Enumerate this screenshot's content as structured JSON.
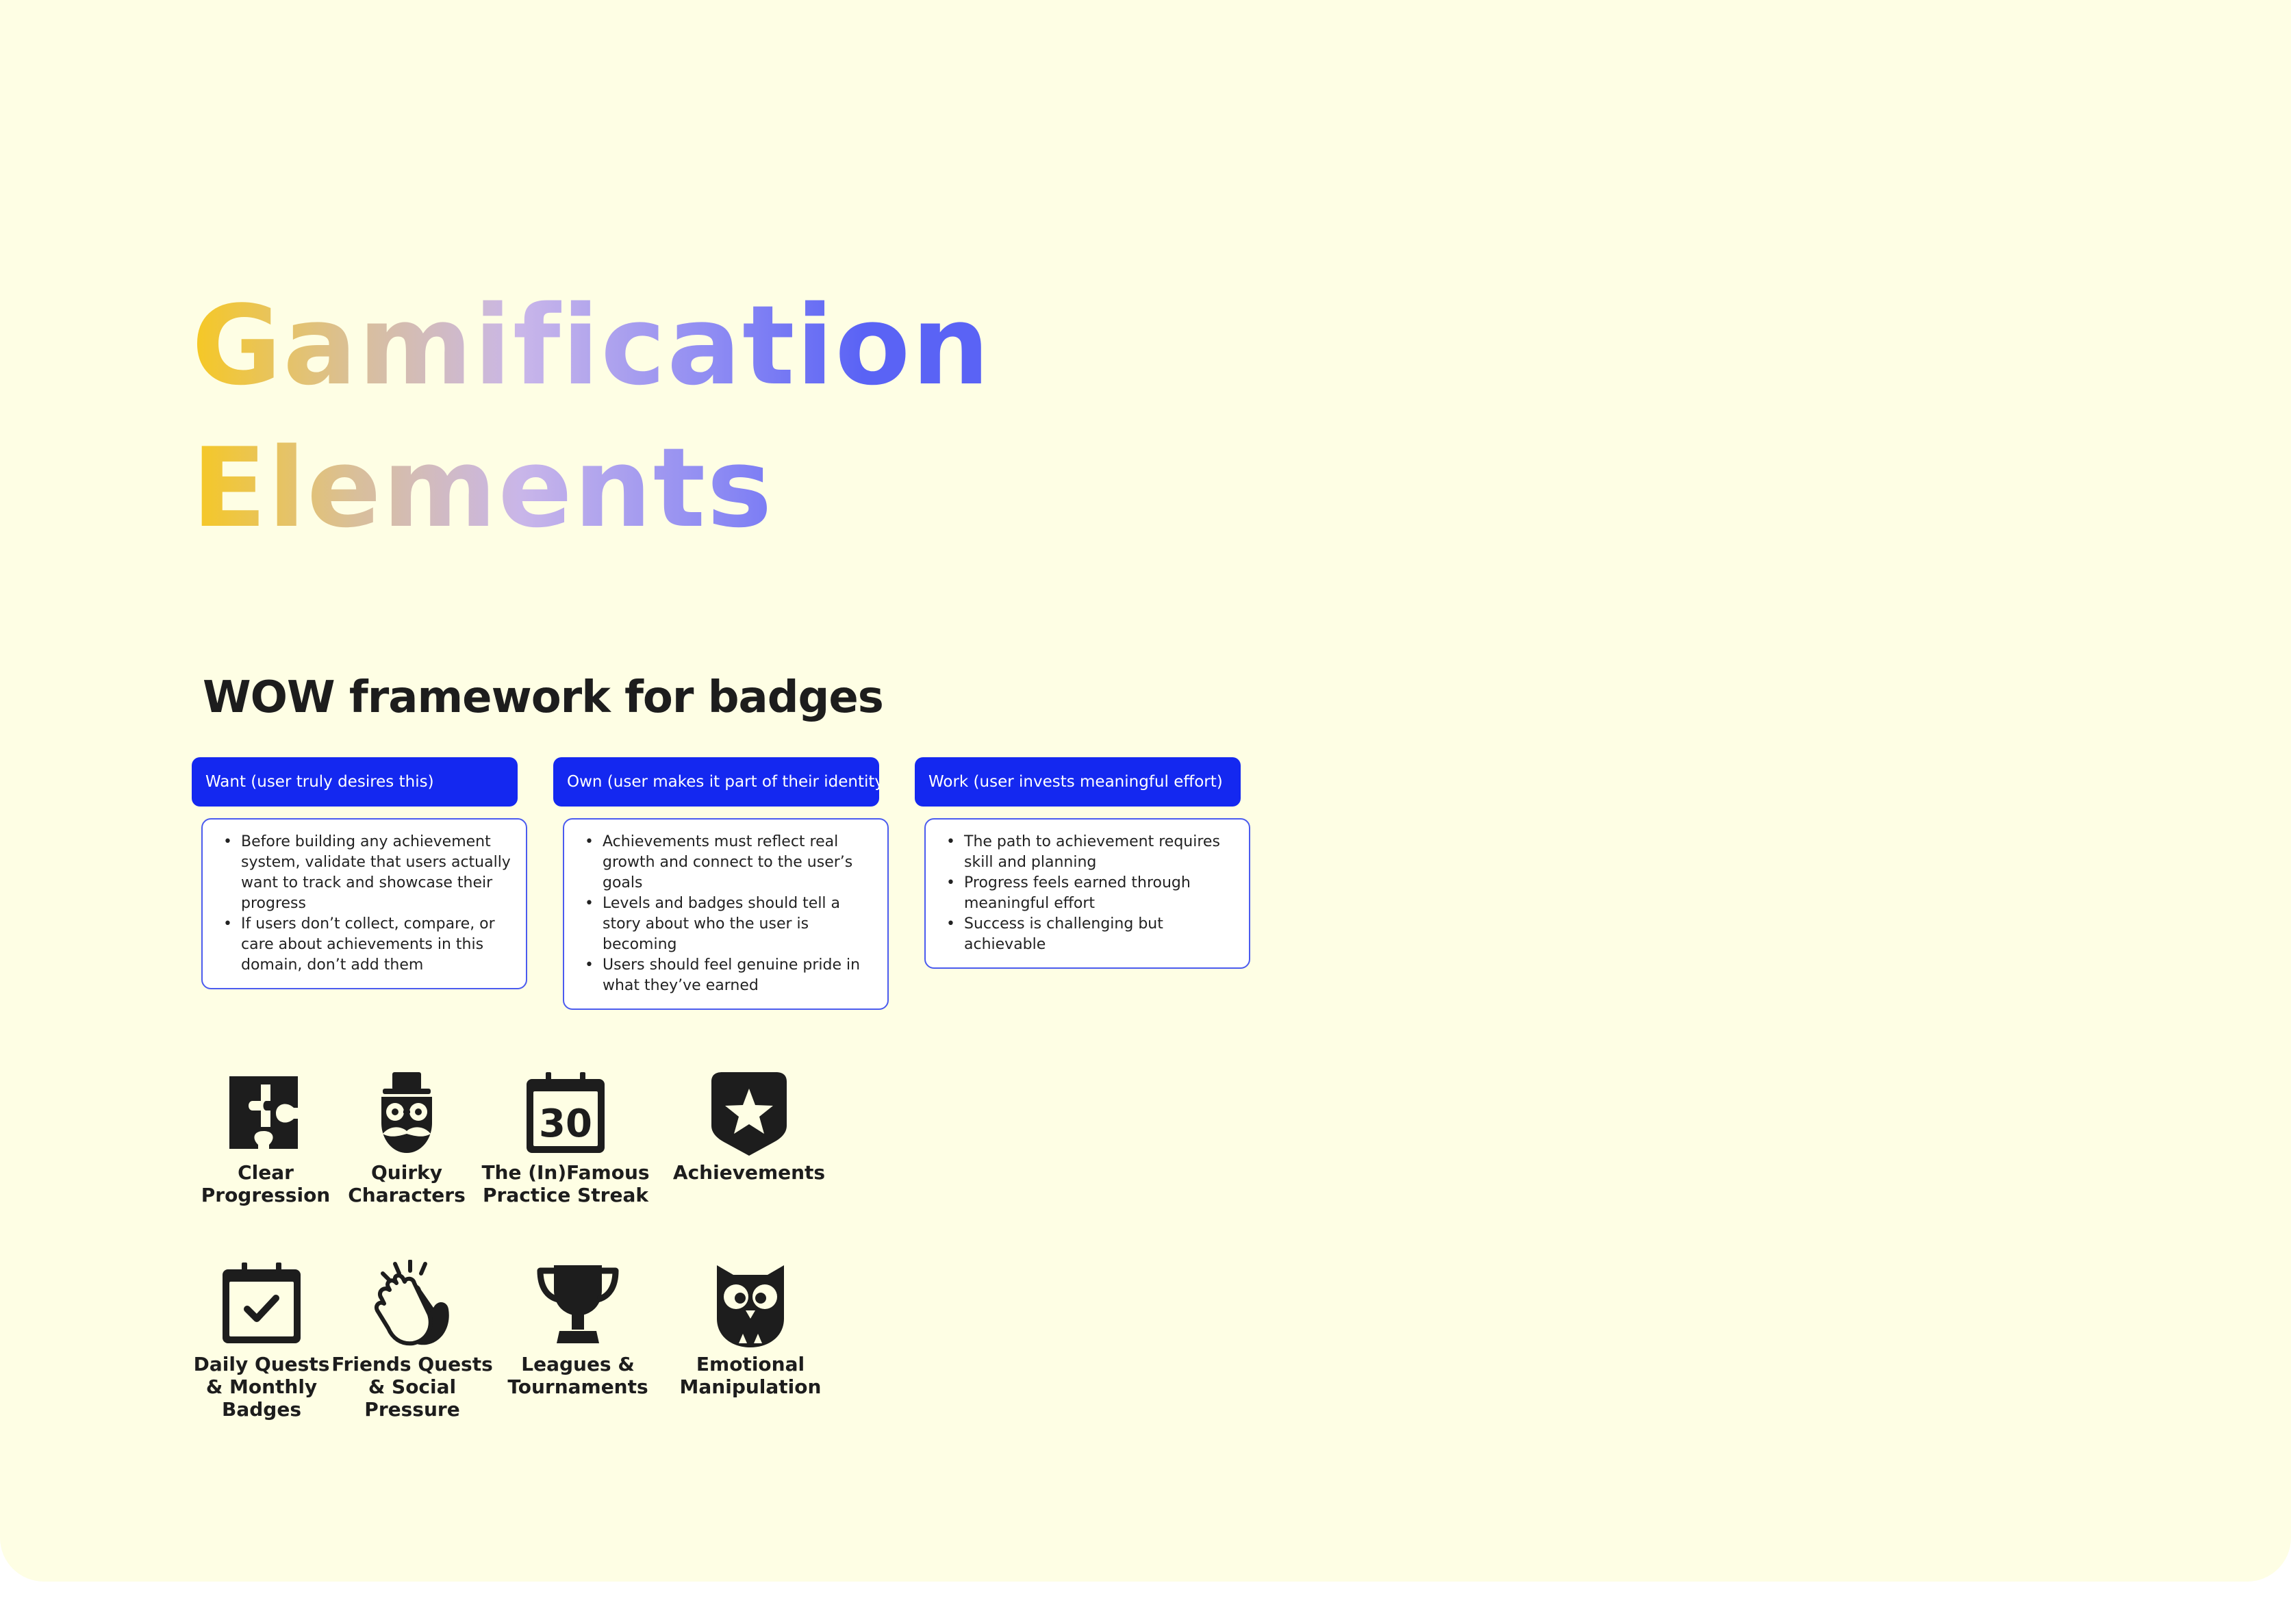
{
  "title": {
    "line1": "Gamification",
    "line2": "Elements"
  },
  "framework": {
    "heading": "WOW framework for badges",
    "columns": [
      {
        "label": "Want (user truly desires this)",
        "bullets": [
          "Before building any achievement system, validate that users actually want to track and showcase their progress",
          "If users don’t collect, compare, or care about achievements in this domain, don’t add them"
        ]
      },
      {
        "label": "Own (user makes it part of their identity)",
        "bullets": [
          "Achievements must reflect real growth and connect to the user’s goals",
          "Levels and badges should tell a story about who the user is becoming",
          "Users should feel genuine pride in what they’ve earned"
        ]
      },
      {
        "label": "Work (user invests meaningful effort)",
        "bullets": [
          "The path to achievement requires skill and planning",
          "Progress feels earned through meaningful effort",
          "Success is challenging but achievable"
        ]
      }
    ]
  },
  "features": [
    {
      "label": "Clear\nProgression",
      "icon": "puzzle-icon"
    },
    {
      "label": "Quirky\nCharacters",
      "icon": "mustache-character-icon"
    },
    {
      "label": "The (In)Famous\nPractice Streak",
      "icon": "calendar-30-icon",
      "icon_text": "30"
    },
    {
      "label": "Achievements",
      "icon": "star-shield-icon"
    },
    {
      "label": "Daily Quests\n& Monthly\nBadges",
      "icon": "calendar-check-icon"
    },
    {
      "label": "Friends Quests\n& Social Pressure",
      "icon": "clapping-hands-icon"
    },
    {
      "label": "Leagues &\nTournaments",
      "icon": "trophy-icon"
    },
    {
      "label": "Emotional\nManipulation",
      "icon": "owl-icon"
    }
  ],
  "colors": {
    "background": "#fefee4",
    "accent": "#1428f0",
    "card_border": "#4b5bef",
    "title_gradient": [
      "#f6c823",
      "#c9b6e9",
      "#5a63f5"
    ],
    "icon": "#1d1d1d"
  }
}
